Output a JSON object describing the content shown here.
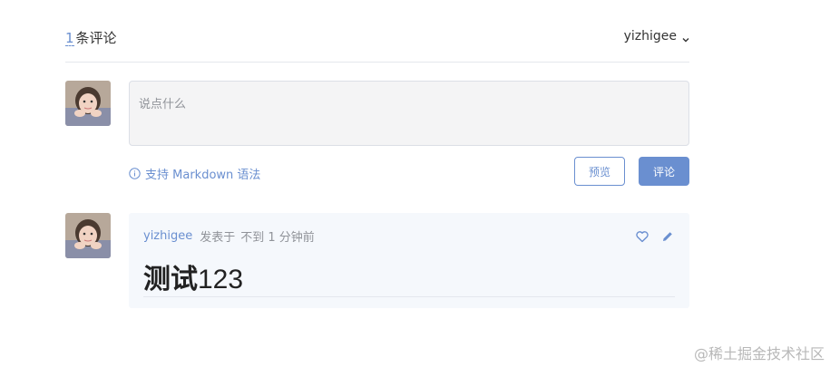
{
  "header": {
    "comment_count": "1",
    "comment_count_suffix": "条评论",
    "username": "yizhigee"
  },
  "compose": {
    "placeholder": "说点什么",
    "markdown_hint": "支持 Markdown 语法",
    "preview_label": "预览",
    "submit_label": "评论"
  },
  "comments": [
    {
      "author": "yizhigee",
      "posted_label": "发表于",
      "time": "不到 1 分钟前",
      "body_bold": "测试",
      "body_rest": "123"
    }
  ],
  "watermark": "@稀土掘金技术社区",
  "colors": {
    "accent": "#6a8fd0",
    "comment_bg": "#f5f8fc",
    "input_bg": "#f4f4f5"
  },
  "icons": {
    "dropdown": "chevron-down-icon",
    "info": "info-icon",
    "like": "heart-icon",
    "edit": "pencil-icon"
  }
}
